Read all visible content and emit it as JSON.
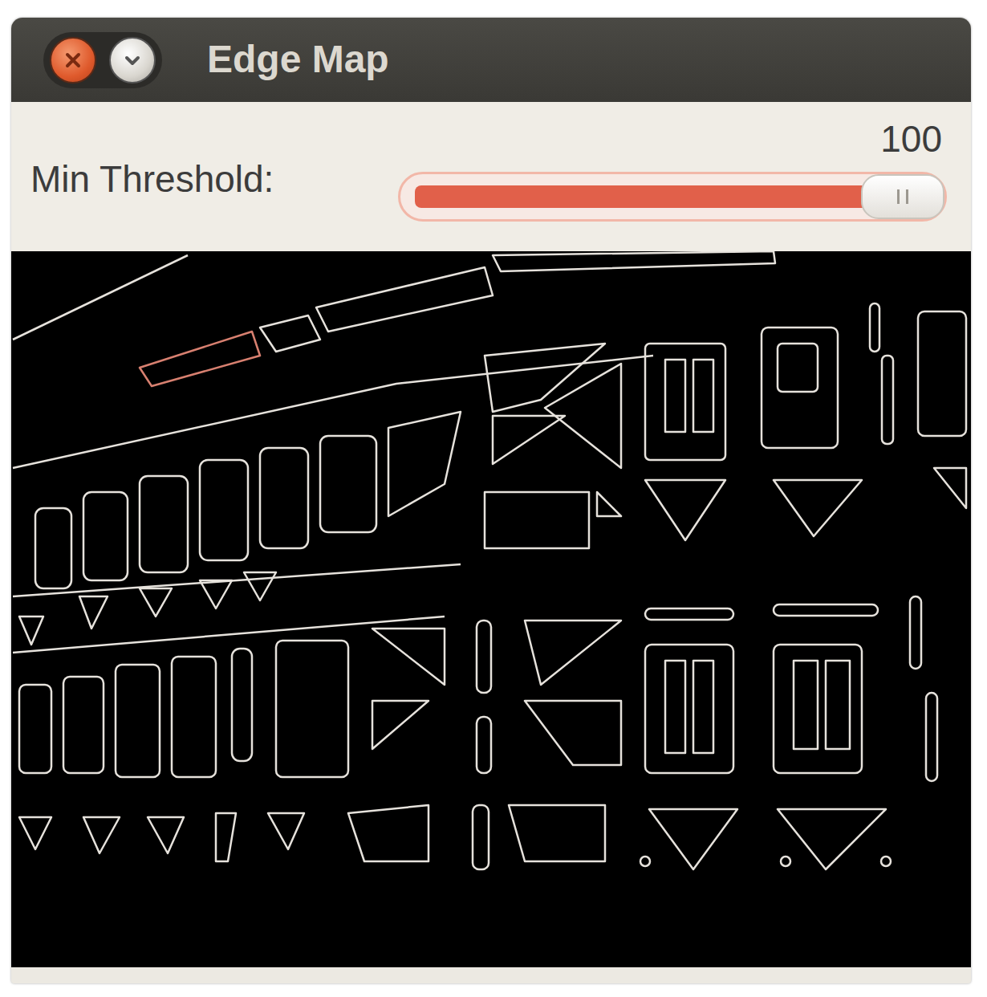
{
  "window": {
    "title": "Edge Map"
  },
  "trackbar": {
    "label": "Min Threshold:",
    "reading": "100",
    "level": 1.0
  }
}
